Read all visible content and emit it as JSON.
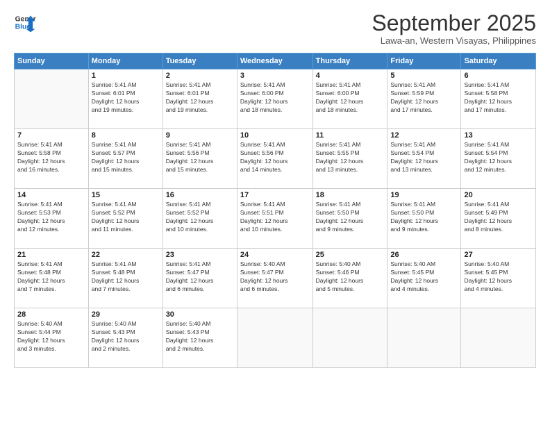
{
  "header": {
    "logo_line1": "General",
    "logo_line2": "Blue",
    "month_title": "September 2025",
    "subtitle": "Lawa-an, Western Visayas, Philippines"
  },
  "days_of_week": [
    "Sunday",
    "Monday",
    "Tuesday",
    "Wednesday",
    "Thursday",
    "Friday",
    "Saturday"
  ],
  "weeks": [
    [
      {
        "day": "",
        "info": ""
      },
      {
        "day": "1",
        "info": "Sunrise: 5:41 AM\nSunset: 6:01 PM\nDaylight: 12 hours\nand 19 minutes."
      },
      {
        "day": "2",
        "info": "Sunrise: 5:41 AM\nSunset: 6:01 PM\nDaylight: 12 hours\nand 19 minutes."
      },
      {
        "day": "3",
        "info": "Sunrise: 5:41 AM\nSunset: 6:00 PM\nDaylight: 12 hours\nand 18 minutes."
      },
      {
        "day": "4",
        "info": "Sunrise: 5:41 AM\nSunset: 6:00 PM\nDaylight: 12 hours\nand 18 minutes."
      },
      {
        "day": "5",
        "info": "Sunrise: 5:41 AM\nSunset: 5:59 PM\nDaylight: 12 hours\nand 17 minutes."
      },
      {
        "day": "6",
        "info": "Sunrise: 5:41 AM\nSunset: 5:58 PM\nDaylight: 12 hours\nand 17 minutes."
      }
    ],
    [
      {
        "day": "7",
        "info": "Sunrise: 5:41 AM\nSunset: 5:58 PM\nDaylight: 12 hours\nand 16 minutes."
      },
      {
        "day": "8",
        "info": "Sunrise: 5:41 AM\nSunset: 5:57 PM\nDaylight: 12 hours\nand 15 minutes."
      },
      {
        "day": "9",
        "info": "Sunrise: 5:41 AM\nSunset: 5:56 PM\nDaylight: 12 hours\nand 15 minutes."
      },
      {
        "day": "10",
        "info": "Sunrise: 5:41 AM\nSunset: 5:56 PM\nDaylight: 12 hours\nand 14 minutes."
      },
      {
        "day": "11",
        "info": "Sunrise: 5:41 AM\nSunset: 5:55 PM\nDaylight: 12 hours\nand 13 minutes."
      },
      {
        "day": "12",
        "info": "Sunrise: 5:41 AM\nSunset: 5:54 PM\nDaylight: 12 hours\nand 13 minutes."
      },
      {
        "day": "13",
        "info": "Sunrise: 5:41 AM\nSunset: 5:54 PM\nDaylight: 12 hours\nand 12 minutes."
      }
    ],
    [
      {
        "day": "14",
        "info": "Sunrise: 5:41 AM\nSunset: 5:53 PM\nDaylight: 12 hours\nand 12 minutes."
      },
      {
        "day": "15",
        "info": "Sunrise: 5:41 AM\nSunset: 5:52 PM\nDaylight: 12 hours\nand 11 minutes."
      },
      {
        "day": "16",
        "info": "Sunrise: 5:41 AM\nSunset: 5:52 PM\nDaylight: 12 hours\nand 10 minutes."
      },
      {
        "day": "17",
        "info": "Sunrise: 5:41 AM\nSunset: 5:51 PM\nDaylight: 12 hours\nand 10 minutes."
      },
      {
        "day": "18",
        "info": "Sunrise: 5:41 AM\nSunset: 5:50 PM\nDaylight: 12 hours\nand 9 minutes."
      },
      {
        "day": "19",
        "info": "Sunrise: 5:41 AM\nSunset: 5:50 PM\nDaylight: 12 hours\nand 9 minutes."
      },
      {
        "day": "20",
        "info": "Sunrise: 5:41 AM\nSunset: 5:49 PM\nDaylight: 12 hours\nand 8 minutes."
      }
    ],
    [
      {
        "day": "21",
        "info": "Sunrise: 5:41 AM\nSunset: 5:48 PM\nDaylight: 12 hours\nand 7 minutes."
      },
      {
        "day": "22",
        "info": "Sunrise: 5:41 AM\nSunset: 5:48 PM\nDaylight: 12 hours\nand 7 minutes."
      },
      {
        "day": "23",
        "info": "Sunrise: 5:41 AM\nSunset: 5:47 PM\nDaylight: 12 hours\nand 6 minutes."
      },
      {
        "day": "24",
        "info": "Sunrise: 5:40 AM\nSunset: 5:47 PM\nDaylight: 12 hours\nand 6 minutes."
      },
      {
        "day": "25",
        "info": "Sunrise: 5:40 AM\nSunset: 5:46 PM\nDaylight: 12 hours\nand 5 minutes."
      },
      {
        "day": "26",
        "info": "Sunrise: 5:40 AM\nSunset: 5:45 PM\nDaylight: 12 hours\nand 4 minutes."
      },
      {
        "day": "27",
        "info": "Sunrise: 5:40 AM\nSunset: 5:45 PM\nDaylight: 12 hours\nand 4 minutes."
      }
    ],
    [
      {
        "day": "28",
        "info": "Sunrise: 5:40 AM\nSunset: 5:44 PM\nDaylight: 12 hours\nand 3 minutes."
      },
      {
        "day": "29",
        "info": "Sunrise: 5:40 AM\nSunset: 5:43 PM\nDaylight: 12 hours\nand 2 minutes."
      },
      {
        "day": "30",
        "info": "Sunrise: 5:40 AM\nSunset: 5:43 PM\nDaylight: 12 hours\nand 2 minutes."
      },
      {
        "day": "",
        "info": ""
      },
      {
        "day": "",
        "info": ""
      },
      {
        "day": "",
        "info": ""
      },
      {
        "day": "",
        "info": ""
      }
    ]
  ]
}
